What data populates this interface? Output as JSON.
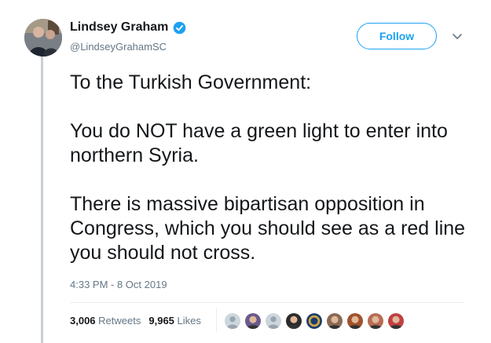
{
  "author": {
    "name": "Lindsey Graham",
    "handle": "@LindseyGrahamSC",
    "verified": true
  },
  "follow_label": "Follow",
  "tweet": {
    "paragraphs": [
      "To the Turkish Government:",
      "You do NOT have a green light to enter into northern Syria.",
      "There is massive bipartisan opposition in Congress, which you should see as a red line you should not cross."
    ],
    "timestamp": "4:33 PM - 8 Oct 2019"
  },
  "stats": {
    "retweets_count": "3,006",
    "retweets_label": "Retweets",
    "likes_count": "9,965",
    "likes_label": "Likes"
  },
  "likers": [
    {
      "kind": "default",
      "color": "#9aa4ad"
    },
    {
      "kind": "photo",
      "color": "#6a5a8c"
    },
    {
      "kind": "default",
      "color": "#9aa4ad"
    },
    {
      "kind": "photo",
      "color": "#2b2b2b"
    },
    {
      "kind": "seal",
      "color": "#c9a64a"
    },
    {
      "kind": "photo",
      "color": "#8a6a55"
    },
    {
      "kind": "photo",
      "color": "#a0522d"
    },
    {
      "kind": "photo",
      "color": "#b86b55"
    },
    {
      "kind": "photo",
      "color": "#c04040"
    }
  ],
  "colors": {
    "accent": "#1da1f2",
    "secondary_text": "#657786",
    "thread_line": "#c8cfd6"
  }
}
